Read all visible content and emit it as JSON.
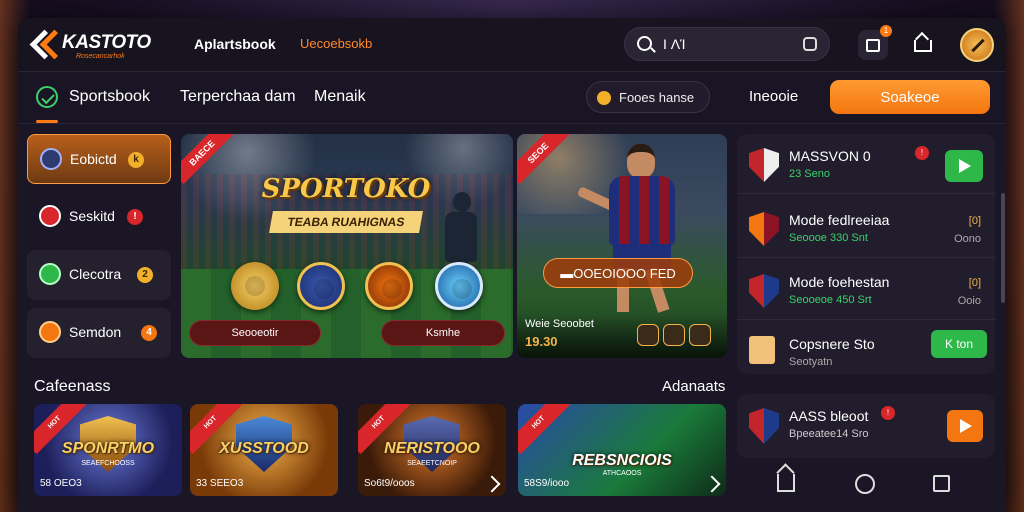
{
  "header": {
    "logo_text": "KASTOTO",
    "logo_sub": "Rosecancarhok",
    "link1": "Aplartsbook",
    "link2": "Uecoebsokb",
    "search_value": "I ΛΊ",
    "notif_count": "1"
  },
  "nav": {
    "sportsbook": "Sportsbook",
    "item2": "Terperchaa dam",
    "item3": "Menaik",
    "pill": "Fooes hanse",
    "link": "Ineooie",
    "cta": "Soakeoe"
  },
  "sidebar": {
    "items": [
      {
        "label": "Eobictd",
        "badge": "k"
      },
      {
        "label": "Seskitd",
        "badge": "!"
      },
      {
        "label": "Clecotra",
        "badge": "2"
      },
      {
        "label": "Semdon",
        "badge": "4"
      }
    ]
  },
  "banner_main": {
    "ribbon": "BAECE",
    "title": "SPORTOKO",
    "subtitle": "TEABA RUAHIGNAS",
    "btn_left": "Seooeotir",
    "btn_right": "Ksmhe"
  },
  "banner_side": {
    "ribbon": "SEOE",
    "plate": "▬OOEOIOOO FED",
    "caption": "Weie Seoobet",
    "price": "19.30"
  },
  "matches": [
    {
      "title": "MASSVON 0",
      "sub": "23 Seno",
      "badge": "!"
    },
    {
      "title": "Mode fedlreeiaa",
      "sub": "Seoooe 330 Snt",
      "odd1": "[0]",
      "odd2": "Oono"
    },
    {
      "title": "Mode foehestan",
      "sub": "Seooeoe 450 Srt",
      "odd1": "[0]",
      "odd2": "Ooio"
    },
    {
      "title": "Copsnere Sto",
      "sub": "Seotyatn",
      "btn": "K ton"
    }
  ],
  "section": {
    "title": "Cafeenass",
    "link": "Adanaats"
  },
  "tiles": [
    {
      "title": "SPONRTMO",
      "sub": "SEAEFCHOOSS",
      "cap": "58 OEO3"
    },
    {
      "title": "XUSSTOOD",
      "sub": "",
      "cap": "33 SEEO3"
    },
    {
      "title": "NERISTOOO",
      "sub": "SEAEETCNOIP",
      "cap": "So6t9/ooos"
    },
    {
      "title": "REBSNCIOIS",
      "sub": "ATHCAOOS",
      "cap": "58S9/iooo"
    }
  ],
  "promo": {
    "title": "AASS bleoot",
    "sub": "Bpeeatee14 Sro",
    "badge": "!"
  },
  "colors": {
    "accent": "#ff7a12",
    "green": "#2fb84a",
    "bg": "#1b1626"
  }
}
